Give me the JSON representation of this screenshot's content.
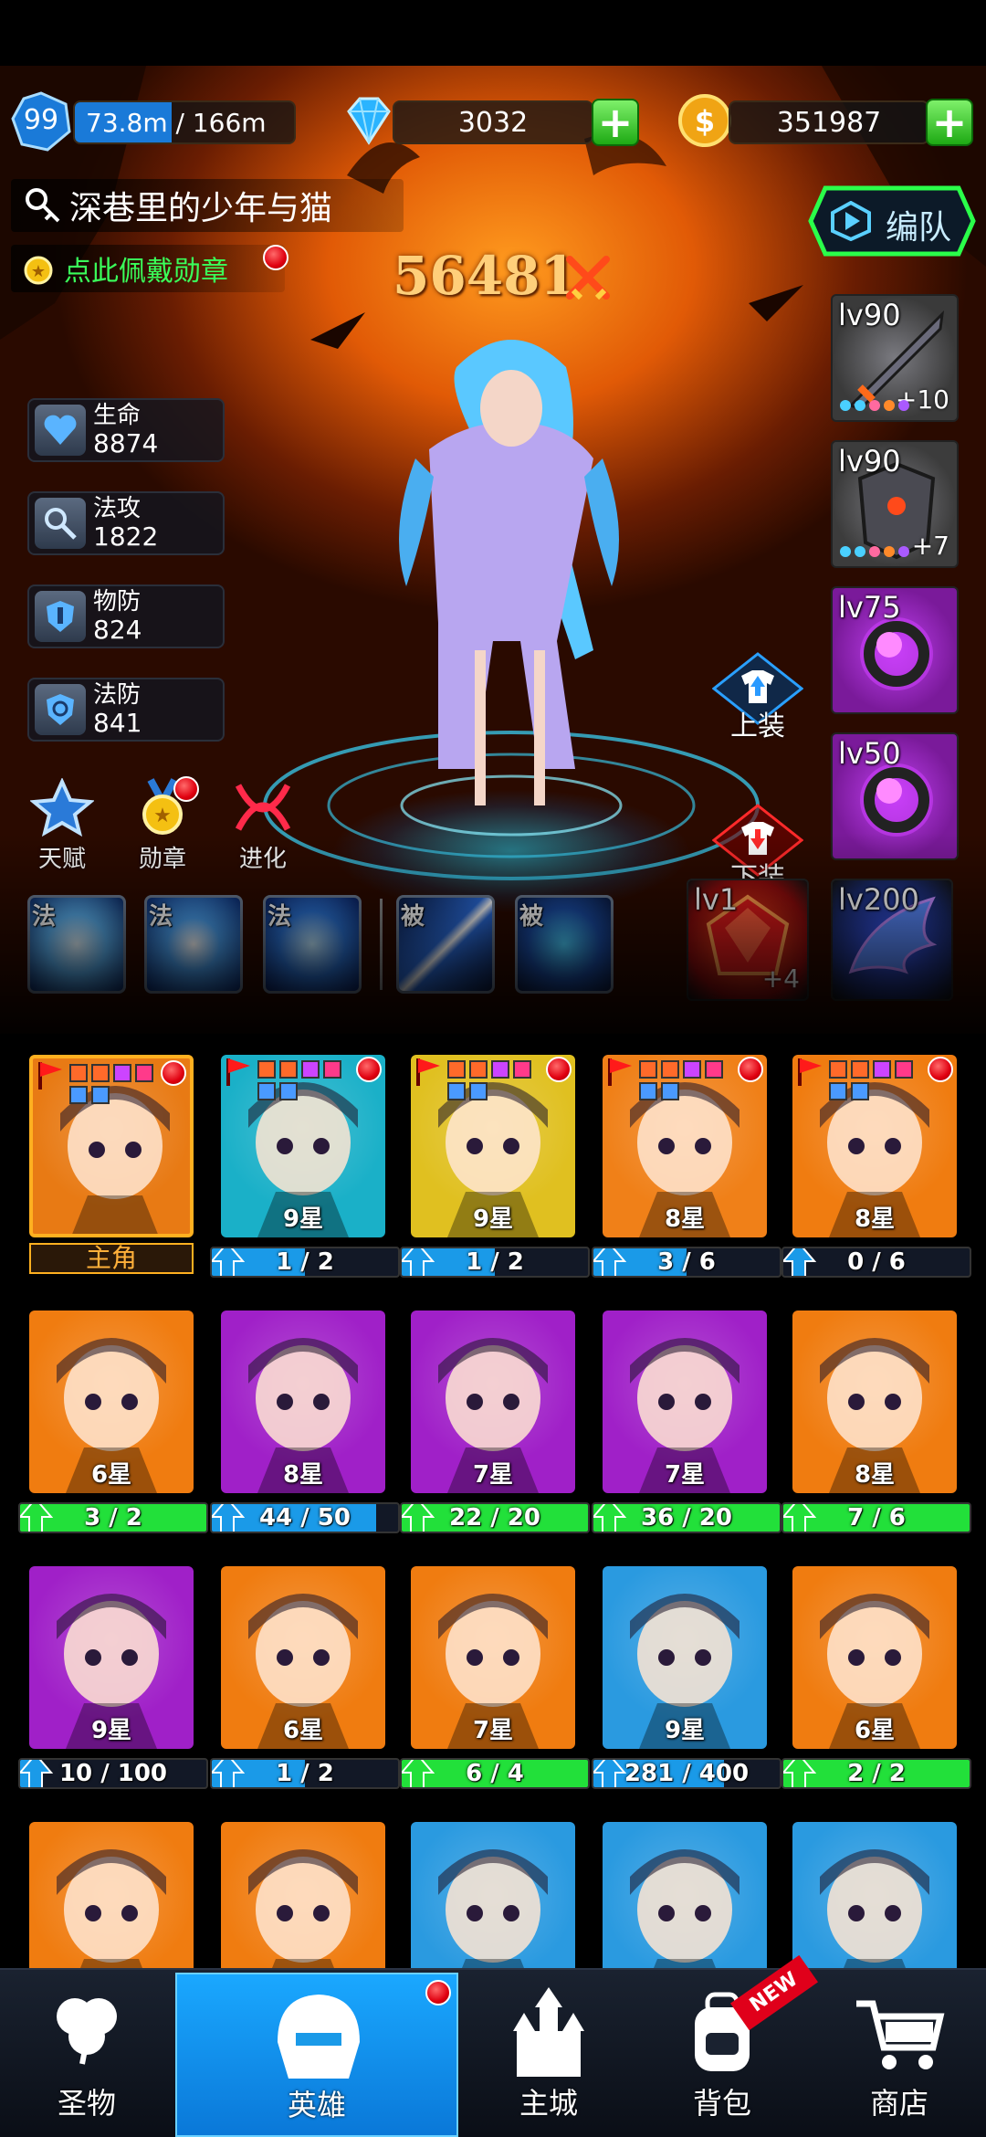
{
  "header": {
    "level": "99",
    "exp_text": "73.8m / 166m",
    "exp_fraction": 0.44,
    "gems": "3032",
    "gold": "351987"
  },
  "hero": {
    "title": "深巷里的少年与猫",
    "medal_hint": "点此佩戴勋章",
    "power": "56481",
    "team_button": "编队"
  },
  "stats": [
    {
      "name": "生命",
      "value": "8874",
      "icon": "heart-icon"
    },
    {
      "name": "法攻",
      "value": "1822",
      "icon": "wand-icon"
    },
    {
      "name": "物防",
      "value": "824",
      "icon": "shield-icon"
    },
    {
      "name": "法防",
      "value": "841",
      "icon": "magic-shield-icon"
    }
  ],
  "actions": {
    "talent": "天赋",
    "medal": "勋章",
    "evolve": "进化",
    "equip_on": "上装",
    "equip_off": "下装"
  },
  "equipment": [
    {
      "level": "lv90",
      "plus": "+10",
      "icon": "sword-icon",
      "color": "#3a3a3a"
    },
    {
      "level": "lv90",
      "plus": "+7",
      "icon": "armor-icon",
      "color": "#3c3c3c"
    },
    {
      "level": "lv75",
      "plus": "",
      "icon": "ring-icon",
      "color": "#7a1a9a"
    },
    {
      "level": "lv50",
      "plus": "",
      "icon": "ring-icon",
      "color": "#7a1a9a"
    }
  ],
  "gems": [
    {
      "level": "lv1",
      "plus": "+4",
      "icon": "red-gem-icon",
      "color": "#8a0c0c"
    },
    {
      "level": "lv200",
      "plus": "",
      "icon": "wing-icon",
      "color": "#1a2a6a"
    }
  ],
  "skills": [
    {
      "tag": "法",
      "icon": "ice-crystal-icon"
    },
    {
      "tag": "法",
      "icon": "snowflake-icon"
    },
    {
      "tag": "法",
      "icon": "blizzard-icon"
    },
    {
      "tag": "被",
      "icon": "blade-icon"
    },
    {
      "tag": "被",
      "icon": "rune-shield-icon"
    }
  ],
  "heroes": [
    {
      "stars": "",
      "label": "主角",
      "progress": "",
      "fill": 0,
      "bg": "#e87a14",
      "icon": "protagonist-portrait"
    },
    {
      "stars": "9星",
      "label": "",
      "progress": "1 / 2",
      "fill": 0.5,
      "bg": "#1ab0c8",
      "icon": "dark-knight-portrait"
    },
    {
      "stars": "9星",
      "label": "",
      "progress": "1 / 2",
      "fill": 0.5,
      "bg": "#e0c020",
      "icon": "sword-spirit-portrait"
    },
    {
      "stars": "8星",
      "label": "",
      "progress": "3 / 6",
      "fill": 0.5,
      "bg": "#f08018",
      "icon": "lilac-girl-portrait"
    },
    {
      "stars": "8星",
      "label": "",
      "progress": "0 / 6",
      "fill": 0,
      "bg": "#f07c10",
      "icon": "tree-ent-portrait"
    },
    {
      "stars": "6星",
      "label": "",
      "progress": "3 / 2",
      "fill": 1,
      "bg": "#f07c10",
      "icon": "ghost-girl-portrait"
    },
    {
      "stars": "8星",
      "label": "",
      "progress": "44 / 50",
      "fill": 0.88,
      "bg": "#a020c8",
      "icon": "dark-witch-portrait"
    },
    {
      "stars": "7星",
      "label": "",
      "progress": "22 / 20",
      "fill": 1,
      "bg": "#a020c8",
      "icon": "elf-girl-portrait"
    },
    {
      "stars": "7星",
      "label": "",
      "progress": "36 / 20",
      "fill": 1,
      "bg": "#a020c8",
      "icon": "shadow-slime-portrait"
    },
    {
      "stars": "8星",
      "label": "",
      "progress": "7 / 6",
      "fill": 1,
      "bg": "#f07c10",
      "icon": "lava-golem-portrait"
    },
    {
      "stars": "9星",
      "label": "",
      "progress": "10 / 100",
      "fill": 0.1,
      "bg": "#a020c8",
      "icon": "panda-portrait"
    },
    {
      "stars": "6星",
      "label": "",
      "progress": "1 / 2",
      "fill": 0.5,
      "bg": "#f07c10",
      "icon": "crying-dino-portrait"
    },
    {
      "stars": "7星",
      "label": "",
      "progress": "6 / 4",
      "fill": 1,
      "bg": "#f07c10",
      "icon": "purple-cat-portrait"
    },
    {
      "stars": "9星",
      "label": "",
      "progress": "281 / 400",
      "fill": 0.7,
      "bg": "#2a9ae0",
      "icon": "glasses-girl-portrait"
    },
    {
      "stars": "6星",
      "label": "",
      "progress": "2 / 2",
      "fill": 1,
      "bg": "#f07c10",
      "icon": "purple-elf-portrait"
    },
    {
      "stars": "",
      "label": "",
      "progress": "",
      "fill": 0,
      "bg": "#f07c10",
      "icon": "white-hair-portrait"
    },
    {
      "stars": "",
      "label": "",
      "progress": "",
      "fill": 0,
      "bg": "#f07c10",
      "icon": "ice-flower-portrait"
    },
    {
      "stars": "",
      "label": "",
      "progress": "",
      "fill": 0,
      "bg": "#2a9ae0",
      "icon": "detective-girl-portrait"
    },
    {
      "stars": "",
      "label": "",
      "progress": "",
      "fill": 0,
      "bg": "#2a9ae0",
      "icon": "hooded-girl-portrait"
    },
    {
      "stars": "",
      "label": "",
      "progress": "",
      "fill": 0,
      "bg": "#2a9ae0",
      "icon": "horned-knight-portrait"
    }
  ],
  "nav": [
    {
      "label": "圣物",
      "icon": "clover-icon"
    },
    {
      "label": "英雄",
      "icon": "helmet-icon"
    },
    {
      "label": "主城",
      "icon": "castle-icon"
    },
    {
      "label": "背包",
      "icon": "backpack-icon",
      "badge": "NEW"
    },
    {
      "label": "商店",
      "icon": "cart-icon"
    }
  ],
  "colors": {
    "accent_blue": "#1a9ae8",
    "progress_green": "#22e03a",
    "progress_blue": "#1a9ae8",
    "gold_text": "#ffb03a",
    "title_green": "#3aff5a"
  }
}
